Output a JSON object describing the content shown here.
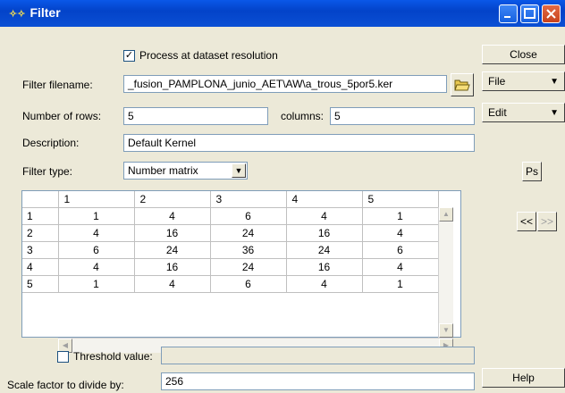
{
  "window": {
    "title": "Filter"
  },
  "process_checkbox": {
    "label": "Process at dataset resolution",
    "checked": "✓"
  },
  "filename": {
    "label": "Filter filename:",
    "value": "_fusion_PAMPLONA_junio_AET\\AW\\a_trous_5por5.ker"
  },
  "rows": {
    "label": "Number of rows:",
    "value": "5"
  },
  "columns": {
    "label": "columns:",
    "value": "5"
  },
  "description": {
    "label": "Description:",
    "value": "Default Kernel"
  },
  "filter_type": {
    "label": "Filter type:",
    "value": "Number matrix"
  },
  "matrix": {
    "col_headers": [
      "1",
      "2",
      "3",
      "4",
      "5"
    ],
    "row_headers": [
      "1",
      "2",
      "3",
      "4",
      "5"
    ],
    "rows": [
      [
        "1",
        "4",
        "6",
        "4",
        "1"
      ],
      [
        "4",
        "16",
        "24",
        "16",
        "4"
      ],
      [
        "6",
        "24",
        "36",
        "24",
        "6"
      ],
      [
        "4",
        "16",
        "24",
        "16",
        "4"
      ],
      [
        "1",
        "4",
        "6",
        "4",
        "1"
      ]
    ]
  },
  "threshold": {
    "label": "Threshold value:",
    "value": ""
  },
  "scale": {
    "label": "Scale factor to divide by:",
    "value": "256"
  },
  "side": {
    "close": "Close",
    "file": "File",
    "edit": "Edit",
    "ps": "Ps",
    "prev": "<<",
    "next": ">>",
    "help": "Help"
  }
}
